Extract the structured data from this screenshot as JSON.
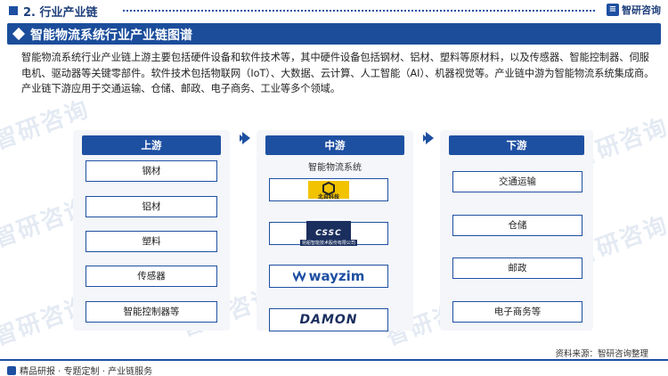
{
  "header": {
    "section_title": "2. 行业产业链",
    "brand": "智研咨询"
  },
  "banner": {
    "title": "智能物流系统行业产业链图谱"
  },
  "description": "智能物流系统行业产业链上游主要包括硬件设备和软件技术等，其中硬件设备包括钢材、铝材、塑料等原材料，以及传感器、智能控制器、伺服电机、驱动器等关键零部件。软件技术包括物联网（IoT）、大数据、云计算、人工智能（AI）、机器视觉等。产业链中游为智能物流系统集成商。产业链下游应用于交通运输、仓储、邮政、电子商务、工业等多个领域。",
  "upstream": {
    "title": "上游",
    "items": [
      "钢材",
      "铝材",
      "塑料",
      "传感器",
      "智能控制器等"
    ]
  },
  "midstream": {
    "title": "中游",
    "subtitle": "智能物流系统",
    "logos": [
      {
        "name": "logo-beiming",
        "text": "北自科技"
      },
      {
        "name": "logo-cssc",
        "text": "CSSC",
        "sub": "昆船智能技术股份有限公司"
      },
      {
        "name": "logo-wayzim",
        "text": "wayzim"
      },
      {
        "name": "logo-damon",
        "text": "DAMON"
      }
    ]
  },
  "downstream": {
    "title": "下游",
    "items": [
      "交通运输",
      "仓储",
      "邮政",
      "电子商务等"
    ]
  },
  "source": "资料来源：智研咨询整理",
  "footer": {
    "services": "精品研报 · 专题定制 · 产业链服务"
  },
  "watermark": "智研咨询",
  "colors": {
    "primary": "#1e50a2",
    "banner": "#1b4d9b"
  }
}
